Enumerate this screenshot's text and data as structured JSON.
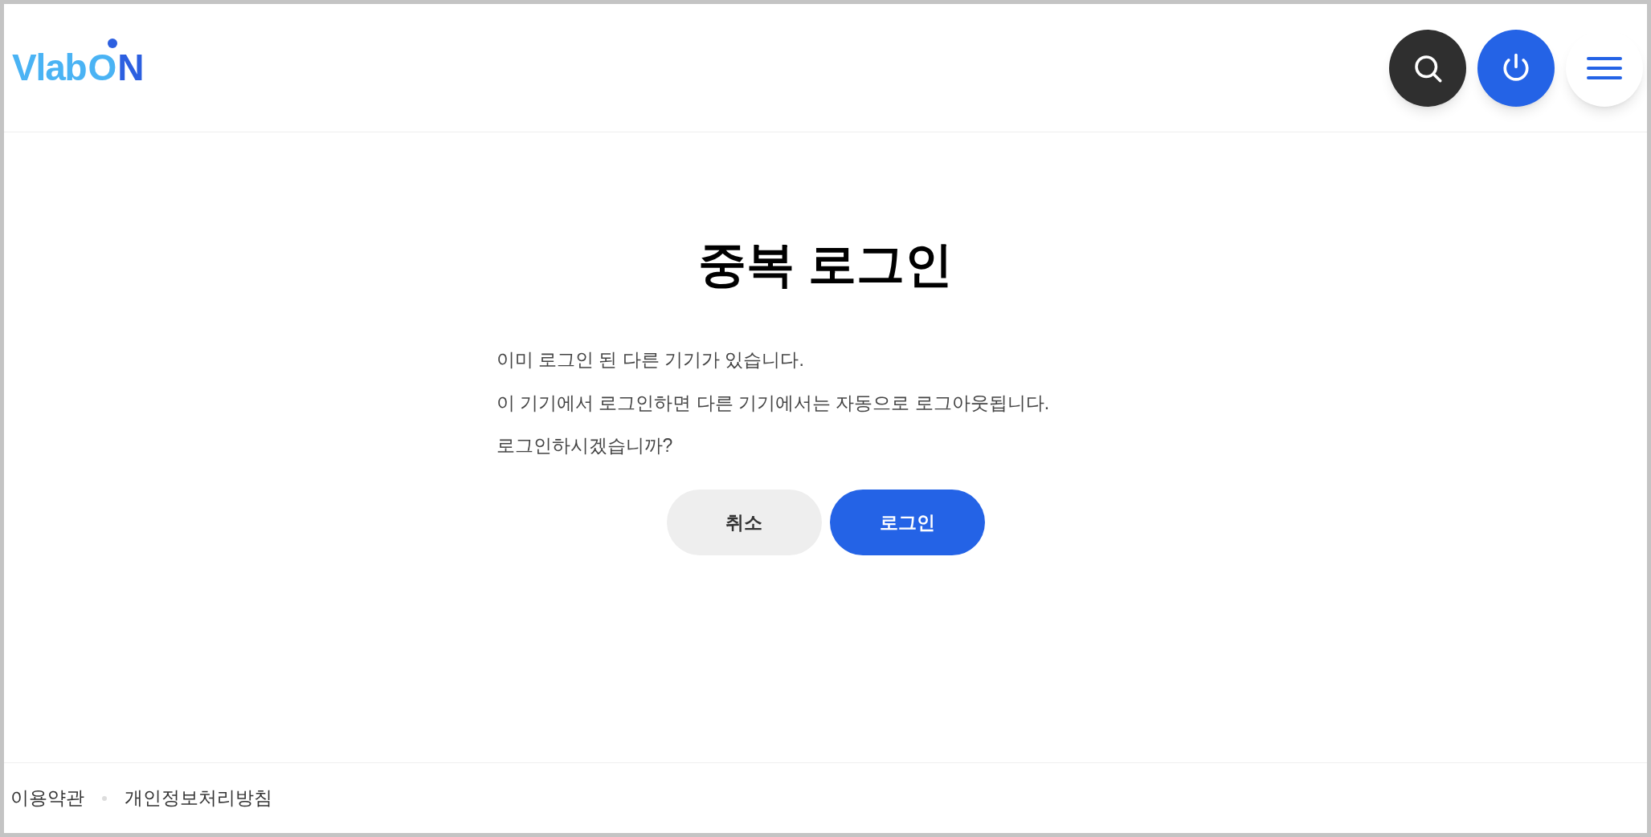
{
  "header": {
    "logo": [
      {
        "text": "Vlab",
        "color": "#4ab3f4"
      },
      {
        "text": "O",
        "color": "#4ab3f4"
      },
      {
        "text": "N",
        "color": "#2c5fe0"
      }
    ]
  },
  "dialog": {
    "title": "중복 로그인",
    "message": [
      "이미 로그인 된 다른 기기가 있습니다.",
      "이 기기에서 로그인하면 다른 기기에서는 자동으로 로그아웃됩니다.",
      "로그인하시겠습니까?"
    ],
    "buttons": [
      {
        "label": "취소",
        "kind": "secondary"
      },
      {
        "label": "로그인",
        "kind": "primary"
      }
    ]
  },
  "footer": {
    "links": [
      "이용약관",
      "개인정보처리방침"
    ]
  }
}
